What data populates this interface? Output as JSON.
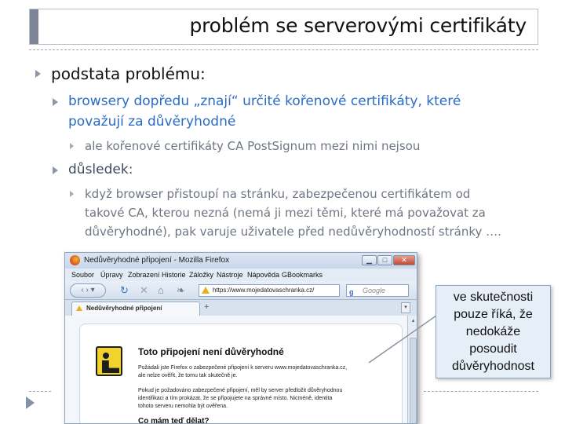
{
  "slide": {
    "title": "problém se serverovými certifikáty",
    "bullets": {
      "b1": "podstata problému:",
      "b1_1_line1": "browsery dopředu „znají“ určité kořenové certifikáty, které",
      "b1_1_line2": "považují za důvěryhodné",
      "b1_1_1": "ale kořenové certifikáty CA PostSignum mezi nimi nejsou",
      "b1_2": "důsledek:",
      "b1_2_1_line1": "když browser přistoupí na stránku, zabezpečenou certifikátem od",
      "b1_2_1_line2": "takové CA, kterou nezná (nemá ji mezi těmi, které má považovat za",
      "b1_2_1_line3": "důvěryhodné), pak varuje uživatele před nedůvěryhodností stránky …."
    }
  },
  "browser": {
    "window_title": "Nedůvěryhodné připojení - Mozilla Firefox",
    "window_controls": {
      "minimize": "▁",
      "maximize": "□",
      "close": "✕"
    },
    "menu": [
      "Soubor",
      "Úpravy",
      "Zobrazení",
      "Historie",
      "Záložky",
      "Nástroje",
      "Nápověda",
      "GBookmarks"
    ],
    "nav": {
      "back_forward": "‹ › ▾",
      "reload": "↻",
      "stop": "✕",
      "home": "⌂",
      "addons": "❧"
    },
    "url": "https://www.mojedatovaschranka.cz/",
    "search_placeholder": "Google",
    "search_engine_icon": "g",
    "tab_label": "Nedůvěryhodné připojení",
    "tab_add": "+",
    "tab_dropdown": "▾",
    "scroll_up": "▴",
    "page": {
      "title": "Toto připojení není důvěryhodné",
      "p1_line1": "Požádali jste Firefox o zabezpečené připojení k serveru www.mojedatovaschranka.cz,",
      "p1_line2": "ale nelze ověřit, že tomu tak skutečně je.",
      "p2_line1": "Pokud je požadováno zabezpečené připojení, měl by server předložit důvěryhodnou",
      "p2_line2": "identifikaci a tím prokázat, že se připojujete na správné místo. Nicméně, identita",
      "p2_line3": "tohoto serveru nemohla být ověřena.",
      "h2": "Co mám teď dělat?"
    }
  },
  "callout": {
    "line1": "ve skutečnosti",
    "line2": "pouze říká, že",
    "line3": "nedokáže",
    "line4": "posoudit",
    "line5": "důvěryhodnost"
  },
  "colors": {
    "title_accent": "#7c8498",
    "level2_blue": "#2a6cc5",
    "level2_dark": "#3f4a5d",
    "level3_gray": "#6e7683",
    "bullet_triangle": "#8b96a6",
    "callout_fill": "#e6eef8",
    "warning_yellow": "#e3b21e"
  }
}
